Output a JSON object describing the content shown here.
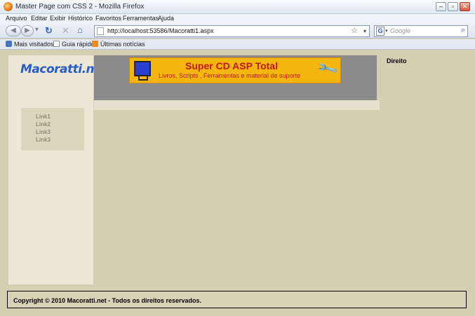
{
  "window": {
    "title": "Master Page com CSS 2 - Mozilla Firefox",
    "controls": [
      "minimize",
      "maximize",
      "close"
    ]
  },
  "menu": [
    "Arquivo",
    "Editar",
    "Exibir",
    "Histórico",
    "Favoritos",
    "Ferramentas",
    "Ajuda"
  ],
  "nav": {
    "url": "http://localhost:53586/Macoratti1.aspx",
    "search_placeholder": "Google"
  },
  "bookmarks": [
    "Mais visitados",
    "Guia rápido",
    "Últimas notícias"
  ],
  "page": {
    "logo_text": "Macoratti.net",
    "banner_title": "Super CD ASP Total",
    "banner_subtitle": "Livros, Scripts , Ferramentas e material de suporte",
    "links": [
      "Link1",
      "Link2",
      "Link3",
      "Link3"
    ],
    "right_label": "Direito",
    "footer_text": "Copyright © 2010 Macoratti.net - Todos os direitos reservados."
  },
  "colors": {
    "page_bg": "#d5cfb2",
    "logo_blue": "#2a5cc8",
    "banner_bg": "#f5b70f",
    "banner_text": "#c01818"
  }
}
